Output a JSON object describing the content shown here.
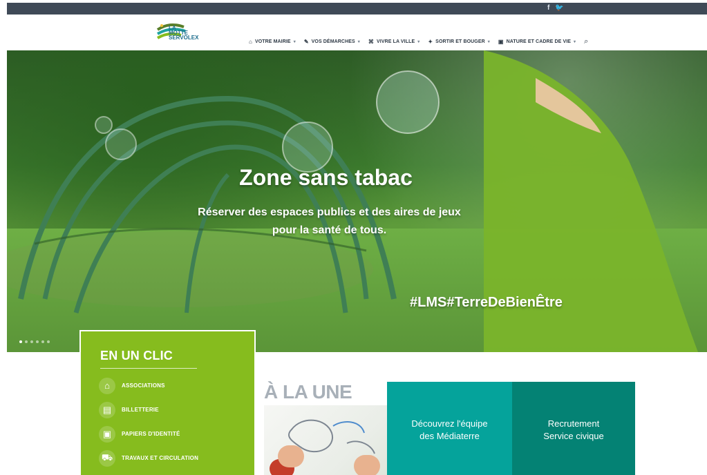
{
  "social": {
    "facebook": "f",
    "twitter": "🐦"
  },
  "logo": {
    "line1": "LA",
    "line2": "MOTTE",
    "line3": "SERVOLEX"
  },
  "nav": [
    {
      "label": "VOTRE MAIRIE",
      "icon": "⌂"
    },
    {
      "label": "VOS DÉMARCHES",
      "icon": "✎"
    },
    {
      "label": "VIVRE LA VILLE",
      "icon": "⌘"
    },
    {
      "label": "SORTIR ET BOUGER",
      "icon": "✦"
    },
    {
      "label": "NATURE ET CADRE DE VIE",
      "icon": "▣"
    }
  ],
  "hero": {
    "title": "Zone sans tabac",
    "subtitle_line1": "Réserver des espaces publics et des aires de jeux",
    "subtitle_line2": "pour la santé de tous.",
    "hashtag": "#LMS#TerreDeBienÊtre"
  },
  "quick": {
    "title": "EN UN CLIC",
    "items": [
      {
        "label": "ASSOCIATIONS",
        "icon": "⌂"
      },
      {
        "label": "BILLETTERIE",
        "icon": "▤"
      },
      {
        "label": "PAPIERS D'IDENTITÉ",
        "icon": "▣"
      },
      {
        "label": "TRAVAUX ET CIRCULATION",
        "icon": "⛟"
      }
    ]
  },
  "news": {
    "title": "À LA UNE"
  },
  "tiles": [
    {
      "line1": "Découvrez l'équipe",
      "line2": "des Médiaterre"
    },
    {
      "line1": "Recrutement",
      "line2": "Service civique"
    }
  ]
}
